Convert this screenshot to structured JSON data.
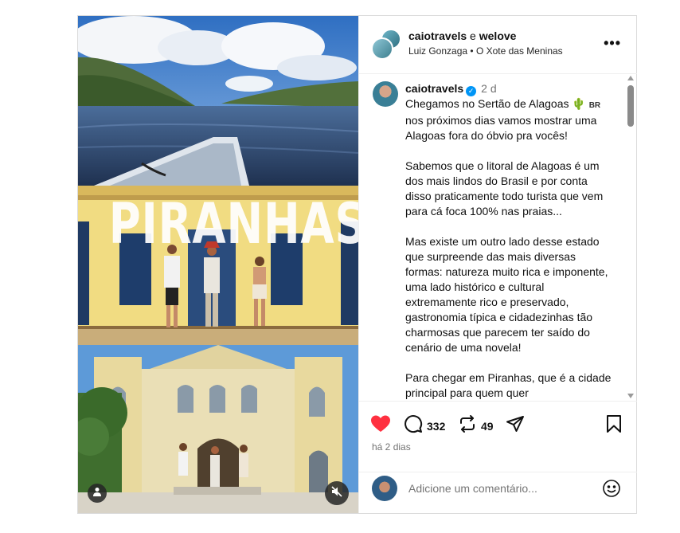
{
  "header": {
    "user_primary": "caiotravels",
    "joiner": " e ",
    "user_secondary": "welove",
    "audio_artist": "Luiz Gonzaga",
    "audio_separator": " • ",
    "audio_track": "O Xote das Meninas",
    "more_label": "•••"
  },
  "media": {
    "overlay_title": "PIRANHAS",
    "tag_icon": "person-tag-icon",
    "mute_icon": "speaker-muted-icon"
  },
  "caption": {
    "username": "caiotravels",
    "verified_mark": "✓",
    "time_short": "2 d",
    "paragraph1_a": "Chegamos no Sertão de Alagoas ",
    "emoji_cactus": "🌵",
    "flag_text": "BR",
    "paragraph1_b": "nos próximos dias vamos mostrar uma Alagoas fora do óbvio pra vocês!",
    "paragraph2": "Sabemos que o litoral de Alagoas é um dos mais lindos do Brasil e por conta disso praticamente todo turista que vem para cá foca 100% nas praias...",
    "paragraph3": "Mas existe um outro lado desse estado que surpreende das mais diversas formas: natureza muito rica e imponente, uma lado histórico e cultural extremamente rico e preservado, gastronomia típica e cidadezinhas tão charmosas que parecem ter saído do cenário de uma novela!",
    "paragraph4": "Para chegar em Piranhas, que é a cidade principal para quem quer"
  },
  "actions": {
    "like_icon": "heart-filled-icon",
    "comment_count": "332",
    "repost_count": "49",
    "posted_ago": "há 2 dias"
  },
  "comment_box": {
    "placeholder": "Adicione um comentário..."
  },
  "colors": {
    "like": "#ff3040",
    "verified": "#0095f6",
    "secondary_text": "#737373",
    "border": "#dbdbdb"
  }
}
